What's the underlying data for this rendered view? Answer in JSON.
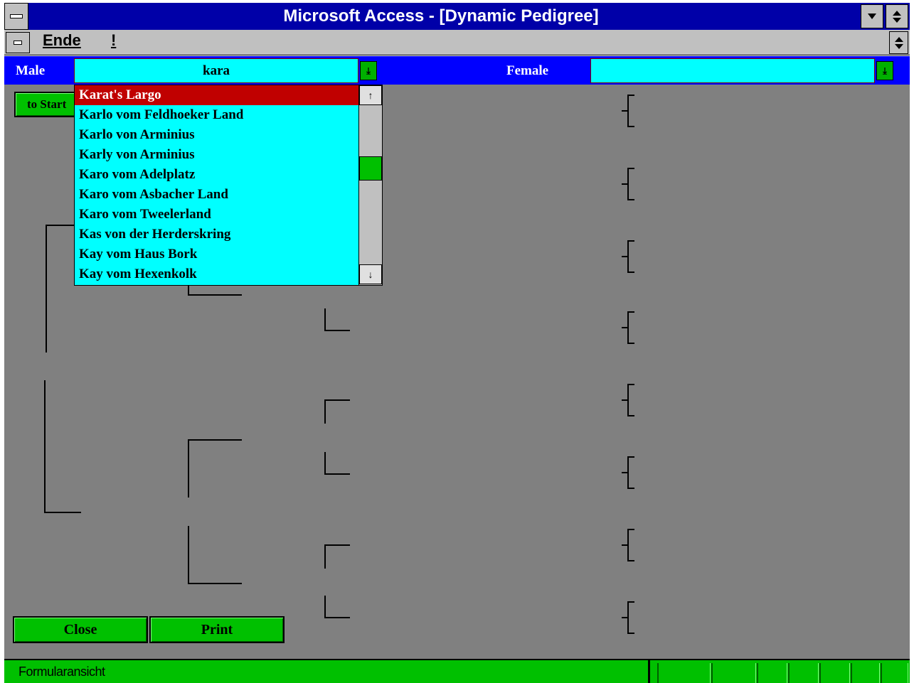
{
  "window": {
    "title": "Microsoft Access - [Dynamic Pedigree]"
  },
  "menu": {
    "items": [
      "Ende",
      "!"
    ]
  },
  "header": {
    "male_label": "Male",
    "male_value": "kara",
    "female_label": "Female",
    "female_value": ""
  },
  "dropdown": {
    "options": [
      "Karat's Largo",
      "Karlo vom Feldhoeker Land",
      "Karlo von Arminius",
      "Karly von Arminius",
      "Karo vom Adelplatz",
      "Karo vom Asbacher Land",
      "Karo vom Tweelerland",
      "Kas von der Herderskring",
      "Kay vom Haus Bork",
      "Kay vom Hexenkolk"
    ],
    "selected_index": 0
  },
  "buttons": {
    "to_start": "to Start",
    "close": "Close",
    "print": "Print"
  },
  "status": {
    "text": "Formularansicht"
  },
  "colors": {
    "title_bar": "#0000a8",
    "header_bar": "#0000ff",
    "combo_fill": "#00ffff",
    "selection": "#c00000",
    "form_body": "#808080",
    "button_green": "#00c000"
  }
}
